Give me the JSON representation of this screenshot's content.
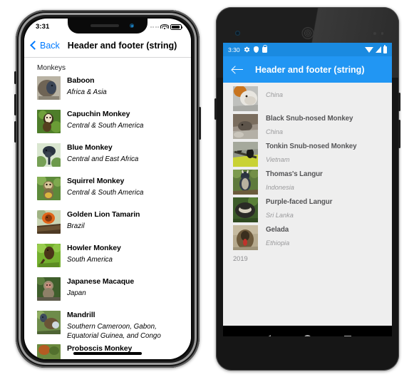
{
  "iphone": {
    "status": {
      "time": "3:31",
      "wifi_icon": "wifi-icon",
      "battery_icon": "battery-icon",
      "signal_icon": "signal-dots-icon"
    },
    "nav": {
      "back_label": "Back",
      "title": "Header and footer (string)"
    },
    "section_header": "Monkeys",
    "rows": [
      {
        "name": "Baboon",
        "location": "Africa & Asia",
        "thumb": "baboon-thumbnail"
      },
      {
        "name": "Capuchin Monkey",
        "location": "Central & South America",
        "thumb": "capuchin-monkey-thumbnail"
      },
      {
        "name": "Blue Monkey",
        "location": "Central and East Africa",
        "thumb": "blue-monkey-thumbnail"
      },
      {
        "name": "Squirrel Monkey",
        "location": "Central & South America",
        "thumb": "squirrel-monkey-thumbnail"
      },
      {
        "name": "Golden Lion Tamarin",
        "location": "Brazil",
        "thumb": "golden-lion-tamarin-thumbnail"
      },
      {
        "name": "Howler Monkey",
        "location": "South America",
        "thumb": "howler-monkey-thumbnail"
      },
      {
        "name": "Japanese Macaque",
        "location": "Japan",
        "thumb": "japanese-macaque-thumbnail"
      },
      {
        "name": "Mandrill",
        "location": "Southern Cameroon, Gabon, Equatorial Guinea, and Congo",
        "thumb": "mandrill-thumbnail"
      },
      {
        "name": "Proboscis Monkey",
        "location": "",
        "thumb": "proboscis-monkey-thumbnail"
      }
    ]
  },
  "android": {
    "status": {
      "time": "3:30",
      "gear_icon": "gear-icon",
      "shield_icon": "shield-icon",
      "lock_icon": "lock-icon",
      "wifi_icon": "wifi-icon",
      "signal_icon": "signal-icon",
      "battery_icon": "battery-icon"
    },
    "appbar": {
      "back_icon": "arrow-back-icon",
      "title": "Header and footer (string)"
    },
    "rows": [
      {
        "name": "",
        "location": "China",
        "thumb": "golden-snub-nosed-monkey-thumbnail"
      },
      {
        "name": "Black Snub-nosed Monkey",
        "location": "China",
        "thumb": "black-snub-nosed-monkey-thumbnail"
      },
      {
        "name": "Tonkin Snub-nosed Monkey",
        "location": "Vietnam",
        "thumb": "tonkin-snub-nosed-monkey-thumbnail"
      },
      {
        "name": "Thomas's Langur",
        "location": "Indonesia",
        "thumb": "thomass-langur-thumbnail"
      },
      {
        "name": "Purple-faced Langur",
        "location": "Sri Lanka",
        "thumb": "purple-faced-langur-thumbnail"
      },
      {
        "name": "Gelada",
        "location": "Ethiopia",
        "thumb": "gelada-thumbnail"
      }
    ],
    "footer": "2019",
    "navbar": {
      "back": "back-triangle-icon",
      "home": "home-circle-icon",
      "recents": "recents-square-icon"
    }
  },
  "colors": {
    "ios_accent": "#007aff",
    "android_appbar": "#2196f3",
    "android_statusbar": "#1a8ae0",
    "android_bg": "#eeeeee"
  }
}
